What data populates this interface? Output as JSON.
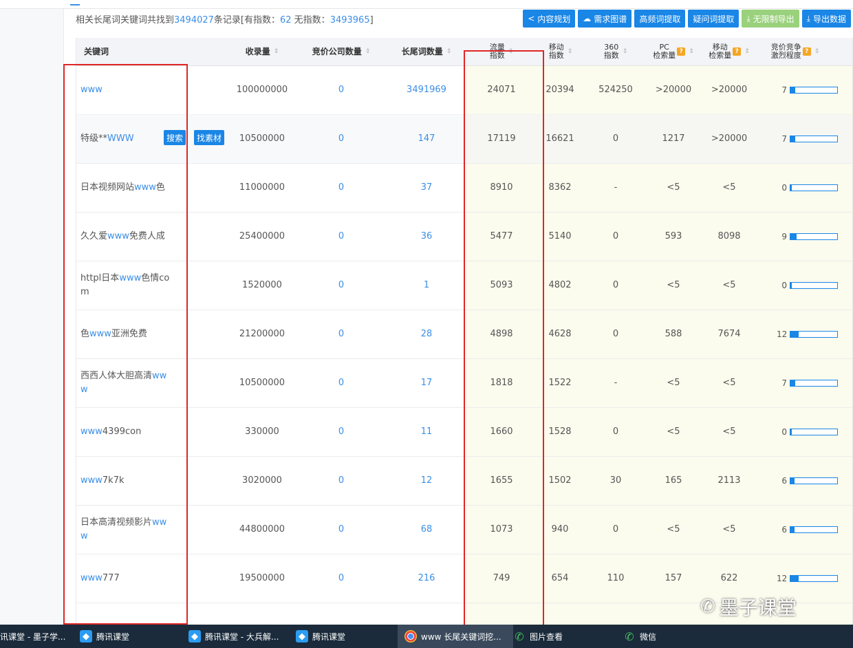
{
  "summary": {
    "prefix": "相关长尾词关键词共找到",
    "total": "3494027",
    "middle": "条记录[有指数：",
    "with_index": "62",
    "middle2": " 无指数：",
    "without_index": "3493965",
    "suffix": "]"
  },
  "toolbar": {
    "content_plan": "内容规划",
    "demand_map": "需求图谱",
    "high_freq": "高频词提取",
    "question": "疑问词提取",
    "unlimited_export": "无限制导出",
    "export_data": "导出数据"
  },
  "columns": {
    "keyword": "关键词",
    "indexed": "收录量",
    "bid_companies": "竞价公司数量",
    "longtail": "长尾词数量",
    "traffic_1": "流量",
    "traffic_2": "指数",
    "mobile_1": "移动",
    "mobile_2": "指数",
    "s360_1": "360",
    "s360_2": "指数",
    "pc_1": "PC",
    "pc_2": "检索量",
    "msearch_1": "移动",
    "msearch_2": "检索量",
    "comp_1": "竞价竞争",
    "comp_2": "激烈程度"
  },
  "row_buttons": {
    "search": "搜索",
    "material": "找素材"
  },
  "rows": [
    {
      "kw_pre": "",
      "kw_hl": "www",
      "kw_post": "",
      "indexed": "100000000",
      "bid": "0",
      "longtail": "3491969",
      "traffic": "24071",
      "mobile": "20394",
      "s360": "524250",
      "pc": ">20000",
      "msearch": ">20000",
      "comp": "7"
    },
    {
      "kw_pre": "特级**",
      "kw_hl": "WWW",
      "kw_post": "",
      "indexed": "10500000",
      "bid": "0",
      "longtail": "147",
      "traffic": "17119",
      "mobile": "16621",
      "s360": "0",
      "pc": "1217",
      "msearch": ">20000",
      "comp": "7"
    },
    {
      "kw_pre": "日本视频网站",
      "kw_hl": "www",
      "kw_post": "色",
      "indexed": "11000000",
      "bid": "0",
      "longtail": "37",
      "traffic": "8910",
      "mobile": "8362",
      "s360": "-",
      "pc": "<5",
      "msearch": "<5",
      "comp": "0"
    },
    {
      "kw_pre": "久久爱",
      "kw_hl": "www",
      "kw_post": "免费人成",
      "indexed": "25400000",
      "bid": "0",
      "longtail": "36",
      "traffic": "5477",
      "mobile": "5140",
      "s360": "0",
      "pc": "593",
      "msearch": "8098",
      "comp": "9"
    },
    {
      "kw_pre": "httpl日本",
      "kw_hl": "www",
      "kw_post": "色情com",
      "indexed": "1520000",
      "bid": "0",
      "longtail": "1",
      "traffic": "5093",
      "mobile": "4802",
      "s360": "0",
      "pc": "<5",
      "msearch": "<5",
      "comp": "0"
    },
    {
      "kw_pre": "色",
      "kw_hl": "www",
      "kw_post": "亚洲免费",
      "indexed": "21200000",
      "bid": "0",
      "longtail": "28",
      "traffic": "4898",
      "mobile": "4628",
      "s360": "0",
      "pc": "588",
      "msearch": "7674",
      "comp": "12"
    },
    {
      "kw_pre": "西西人体大胆高清",
      "kw_hl": "www",
      "kw_post": "",
      "indexed": "10500000",
      "bid": "0",
      "longtail": "17",
      "traffic": "1818",
      "mobile": "1522",
      "s360": "-",
      "pc": "<5",
      "msearch": "<5",
      "comp": "7"
    },
    {
      "kw_pre": "",
      "kw_hl": "www",
      "kw_post": "4399con",
      "indexed": "330000",
      "bid": "0",
      "longtail": "11",
      "traffic": "1660",
      "mobile": "1528",
      "s360": "0",
      "pc": "<5",
      "msearch": "<5",
      "comp": "0"
    },
    {
      "kw_pre": "",
      "kw_hl": "www",
      "kw_post": "7k7k",
      "indexed": "3020000",
      "bid": "0",
      "longtail": "12",
      "traffic": "1655",
      "mobile": "1502",
      "s360": "30",
      "pc": "165",
      "msearch": "2113",
      "comp": "6"
    },
    {
      "kw_pre": "日本高清视频影片",
      "kw_hl": "www",
      "kw_post": "",
      "indexed": "44800000",
      "bid": "0",
      "longtail": "68",
      "traffic": "1073",
      "mobile": "940",
      "s360": "0",
      "pc": "<5",
      "msearch": "<5",
      "comp": "6"
    },
    {
      "kw_pre": "",
      "kw_hl": "www",
      "kw_post": "777",
      "indexed": "19500000",
      "bid": "0",
      "longtail": "216",
      "traffic": "749",
      "mobile": "654",
      "s360": "110",
      "pc": "157",
      "msearch": "622",
      "comp": "12"
    },
    {
      "kw_pre": "",
      "kw_hl": "",
      "kw_post": "",
      "indexed": "",
      "bid": "",
      "longtail": "",
      "traffic": "",
      "mobile": "",
      "s360": "",
      "pc": "",
      "msearch": "",
      "comp": ""
    }
  ],
  "watermark": "墨子课堂",
  "taskbar": [
    {
      "label": "讯课堂 - 墨子学...",
      "icon": "none"
    },
    {
      "label": "腾讯课堂",
      "icon": "tencent-classroom-icon"
    },
    {
      "label": "腾讯课堂 - 大兵解...",
      "icon": "tencent-classroom-icon"
    },
    {
      "label": "腾讯课堂",
      "icon": "tencent-classroom-icon"
    },
    {
      "label": "www 长尾关键词挖...",
      "icon": "chrome-icon"
    },
    {
      "label": "图片查看",
      "icon": "wechat-icon"
    },
    {
      "label": "微信",
      "icon": "wechat-icon"
    }
  ],
  "colors": {
    "accent": "#1a86e6",
    "link": "#3a8ee6",
    "annotation": "#e02525",
    "green_button": "#9ad17c",
    "highlight_bg": "#fbfbee"
  }
}
